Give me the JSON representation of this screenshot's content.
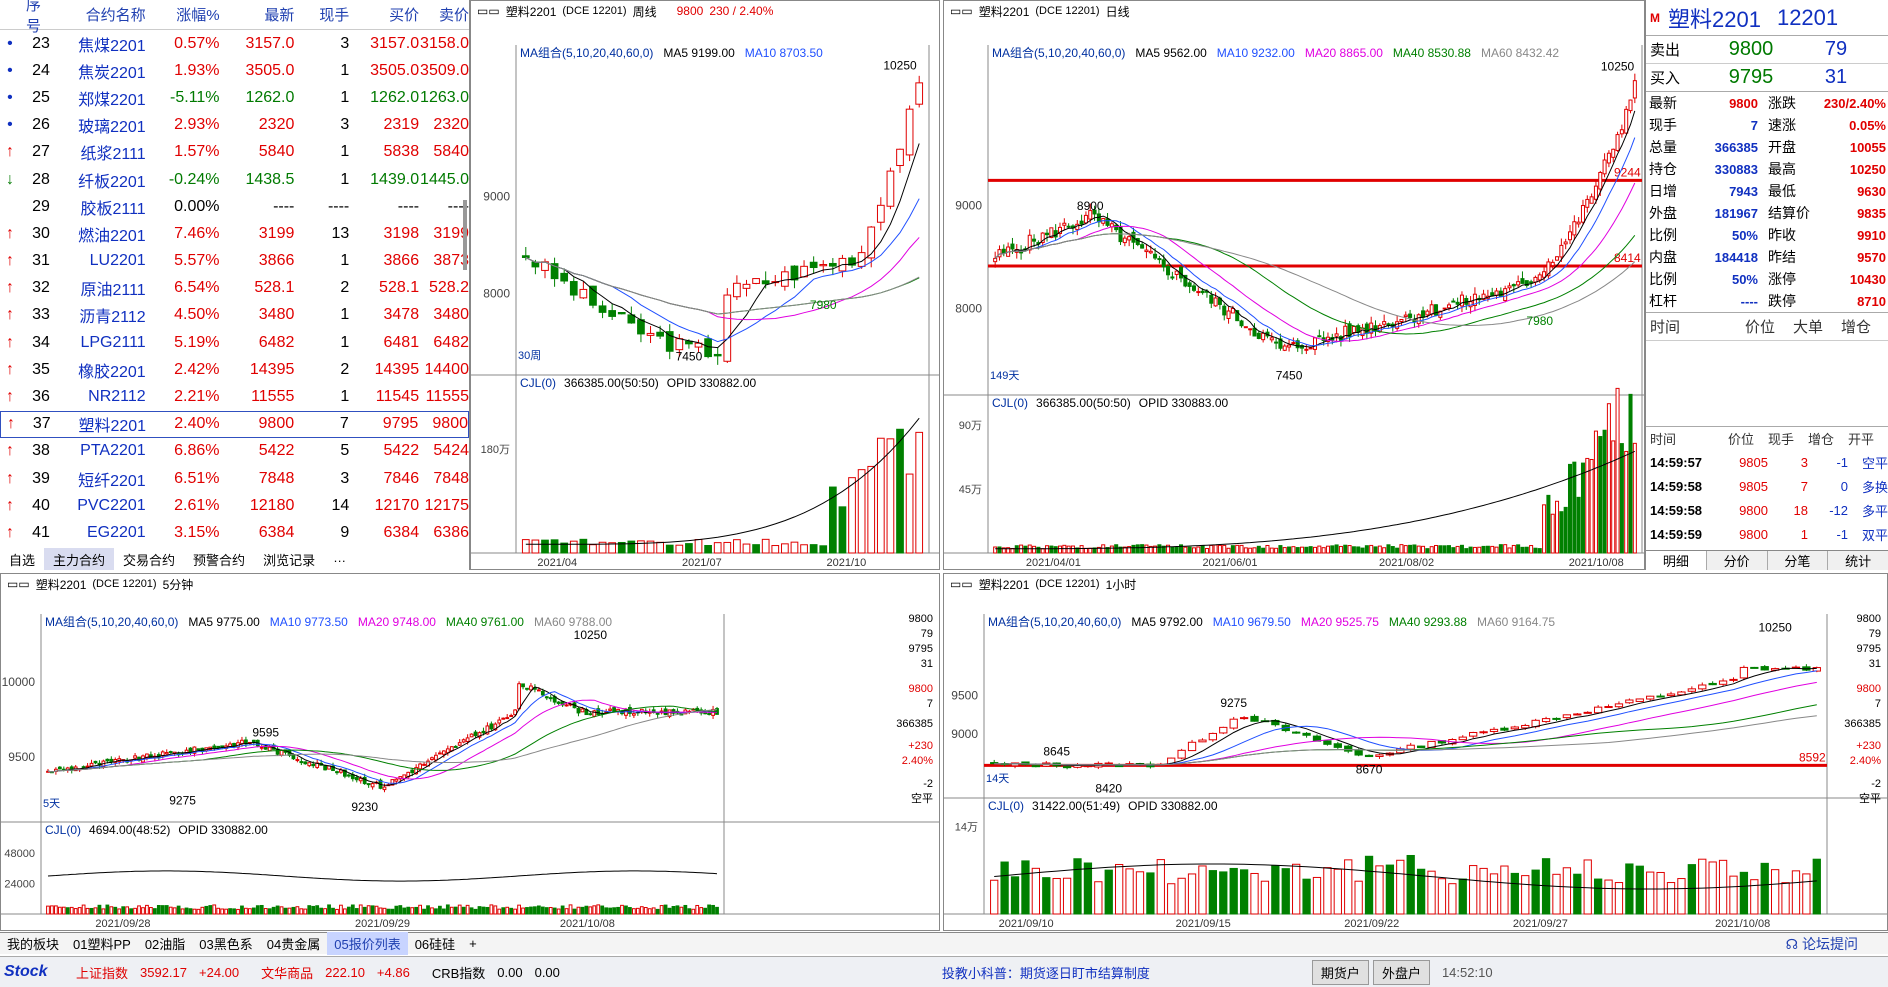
{
  "quote": {
    "headers": [
      "序号",
      "合约名称",
      "涨幅%",
      "最新",
      "现手",
      "买价",
      "卖价"
    ],
    "rows": [
      {
        "no": "23",
        "name": "焦煤2201",
        "chg": "0.57%",
        "last": "3157.0",
        "vol": "3",
        "bid": "3157.0",
        "ask": "3158.0",
        "dir": "dot",
        "up": true
      },
      {
        "no": "24",
        "name": "焦炭2201",
        "chg": "1.93%",
        "last": "3505.0",
        "vol": "1",
        "bid": "3505.0",
        "ask": "3509.0",
        "dir": "dot",
        "up": true
      },
      {
        "no": "25",
        "name": "郑煤2201",
        "chg": "-5.11%",
        "last": "1262.0",
        "vol": "1",
        "bid": "1262.0",
        "ask": "1263.0",
        "dir": "dot",
        "up": false
      },
      {
        "no": "26",
        "name": "玻璃2201",
        "chg": "2.93%",
        "last": "2320",
        "vol": "3",
        "bid": "2319",
        "ask": "2320",
        "dir": "dot",
        "up": true
      },
      {
        "no": "27",
        "name": "纸浆2111",
        "chg": "1.57%",
        "last": "5840",
        "vol": "1",
        "bid": "5838",
        "ask": "5840",
        "dir": "↑",
        "up": true
      },
      {
        "no": "28",
        "name": "纤板2201",
        "chg": "-0.24%",
        "last": "1438.5",
        "vol": "1",
        "bid": "1439.0",
        "ask": "1445.0",
        "dir": "↓",
        "up": false
      },
      {
        "no": "29",
        "name": "胶板2111",
        "chg": "0.00%",
        "last": "----",
        "vol": "----",
        "bid": "----",
        "ask": "----",
        "dir": "",
        "up": null
      },
      {
        "no": "30",
        "name": "燃油2201",
        "chg": "7.46%",
        "last": "3199",
        "vol": "13",
        "bid": "3198",
        "ask": "3199",
        "dir": "↑",
        "up": true
      },
      {
        "no": "31",
        "name": "LU2201",
        "chg": "5.57%",
        "last": "3866",
        "vol": "1",
        "bid": "3866",
        "ask": "3873",
        "dir": "↑",
        "up": true
      },
      {
        "no": "32",
        "name": "原油2111",
        "chg": "6.54%",
        "last": "528.1",
        "vol": "2",
        "bid": "528.1",
        "ask": "528.2",
        "dir": "↑",
        "up": true
      },
      {
        "no": "33",
        "name": "沥青2112",
        "chg": "4.50%",
        "last": "3480",
        "vol": "1",
        "bid": "3478",
        "ask": "3480",
        "dir": "↑",
        "up": true
      },
      {
        "no": "34",
        "name": "LPG2111",
        "chg": "5.19%",
        "last": "6482",
        "vol": "1",
        "bid": "6481",
        "ask": "6482",
        "dir": "↑",
        "up": true
      },
      {
        "no": "35",
        "name": "橡胶2201",
        "chg": "2.42%",
        "last": "14395",
        "vol": "2",
        "bid": "14395",
        "ask": "14400",
        "dir": "↑",
        "up": true
      },
      {
        "no": "36",
        "name": "NR2112",
        "chg": "2.21%",
        "last": "11555",
        "vol": "1",
        "bid": "11545",
        "ask": "11555",
        "dir": "↑",
        "up": true
      },
      {
        "no": "37",
        "name": "塑料2201",
        "chg": "2.40%",
        "last": "9800",
        "vol": "7",
        "bid": "9795",
        "ask": "9800",
        "dir": "↑",
        "up": true,
        "sel": true
      },
      {
        "no": "38",
        "name": "PTA2201",
        "chg": "6.86%",
        "last": "5422",
        "vol": "5",
        "bid": "5422",
        "ask": "5424",
        "dir": "↑",
        "up": true
      },
      {
        "no": "39",
        "name": "短纤2201",
        "chg": "6.51%",
        "last": "7848",
        "vol": "3",
        "bid": "7846",
        "ask": "7848",
        "dir": "↑",
        "up": true
      },
      {
        "no": "40",
        "name": "PVC2201",
        "chg": "2.61%",
        "last": "12180",
        "vol": "14",
        "bid": "12170",
        "ask": "12175",
        "dir": "↑",
        "up": true
      },
      {
        "no": "41",
        "name": "EG2201",
        "chg": "3.15%",
        "last": "6384",
        "vol": "9",
        "bid": "6384",
        "ask": "6386",
        "dir": "↑",
        "up": true
      }
    ],
    "tabs": [
      "自选",
      "主力合约",
      "交易合约",
      "预警合约",
      "浏览记录",
      "…"
    ]
  },
  "weekly": {
    "title": "塑料2201",
    "code": "(DCE 12201)",
    "period": "周线",
    "price": "9800",
    "chg": "230 / 2.40%",
    "ma": "MA组合(5,10,20,40,60,0)",
    "ma5": "MA5 9199.00",
    "ma10": "MA10 8703.50",
    "hi": "10250",
    "lo": "7450",
    "lo2": "7980",
    "y1": "9000",
    "y2": "8000",
    "cnt": "30周",
    "vol": "CJL(0)",
    "volv": "366385.00(50:50)",
    "opid": "OPID 330882.00",
    "vy": "180万",
    "dates": [
      "2021/04",
      "2021/07",
      "2021/10"
    ]
  },
  "daily": {
    "title": "塑料2201",
    "code": "(DCE 12201)",
    "period": "日线",
    "ma": "MA组合(5,10,20,40,60,0)",
    "ma5": "MA5 9562.00",
    "ma10": "MA10 9232.00",
    "ma20": "MA20 8865.00",
    "ma40": "MA40 8530.88",
    "ma60": "MA60 8432.42",
    "hi": "10250",
    "l1": "8900",
    "lo": "7450",
    "lo2": "7980",
    "r1": "9244",
    "r2": "8414",
    "y1": "9000",
    "y2": "8000",
    "cnt": "149天",
    "vol": "CJL(0)",
    "volv": "366385.00(50:50)",
    "opid": "OPID 330883.00",
    "vy1": "90万",
    "vy2": "45万",
    "dates": [
      "2021/04/01",
      "2021/06/01",
      "2021/08/02",
      "2021/10/08"
    ]
  },
  "info": {
    "title": "塑料2201",
    "code": "12201",
    "sell": {
      "label": "卖出",
      "price": "9800",
      "qty": "79"
    },
    "buy": {
      "label": "买入",
      "price": "9795",
      "qty": "31"
    },
    "rows": [
      [
        "最新",
        "9800",
        "涨跌",
        "230/2.40%"
      ],
      [
        "现手",
        "7",
        "速涨",
        "0.05%"
      ],
      [
        "总量",
        "366385",
        "开盘",
        "10055"
      ],
      [
        "持仓",
        "330883",
        "最高",
        "10250"
      ],
      [
        "日增",
        "7943",
        "最低",
        "9630"
      ],
      [
        "外盘",
        "181967",
        "结算价",
        "9835"
      ],
      [
        "比例",
        "50%",
        "昨收",
        "9910"
      ],
      [
        "内盘",
        "184418",
        "昨结",
        "9570"
      ],
      [
        "比例",
        "50%",
        "涨停",
        "10430"
      ],
      [
        "杠杆",
        "----",
        "跌停",
        "8710"
      ]
    ],
    "th1": [
      "时间",
      "价位",
      "大单",
      "增仓"
    ],
    "th2": [
      "时间",
      "价位",
      "现手",
      "增仓",
      "开平"
    ],
    "ticks": [
      [
        "14:59:57",
        "9805",
        "3",
        "-1",
        "空平"
      ],
      [
        "14:59:58",
        "9805",
        "7",
        "0",
        "多换"
      ],
      [
        "14:59:58",
        "9800",
        "18",
        "-12",
        "多平"
      ],
      [
        "14:59:59",
        "9800",
        "1",
        "-1",
        "双平"
      ],
      [
        "14:59:59",
        "9800",
        "7",
        "-2",
        "空平"
      ]
    ],
    "tabs": [
      "明细",
      "分价",
      "分笔",
      "统计"
    ]
  },
  "m5": {
    "title": "塑料2201",
    "code": "(DCE 12201)",
    "period": "5分钟",
    "ma": "MA组合(5,10,20,40,60,0)",
    "ma5": "MA5 9775.00",
    "ma10": "MA10 9773.50",
    "ma20": "MA20 9748.00",
    "ma40": "MA40 9761.00",
    "ma60": "MA60 9788.00",
    "hi": "10250",
    "p1": "9595",
    "p2": "9275",
    "p3": "9230",
    "y1": "10000",
    "y2": "9500",
    "cnt": "5天",
    "vol": "CJL(0)",
    "volv": "4694.00(48:52)",
    "opid": "OPID 330882.00",
    "vy1": "48000",
    "vy2": "24000",
    "dates": [
      "2021/09/28",
      "2021/09/29",
      "2021/10/08"
    ],
    "side": [
      "9800",
      "79",
      "9795",
      "31",
      "9800",
      "7",
      "366385",
      "+230",
      "2.40%",
      "-2",
      "空平"
    ]
  },
  "h1": {
    "title": "塑料2201",
    "code": "(DCE 12201)",
    "period": "1小时",
    "ma": "MA组合(5,10,20,40,60,0)",
    "ma5": "MA5 9792.00",
    "ma10": "MA10 9679.50",
    "ma20": "MA20 9525.75",
    "ma40": "MA40 9293.88",
    "ma60": "MA60 9164.75",
    "hi": "10250",
    "p1": "9275",
    "p2": "8645",
    "p3": "8420",
    "p4": "8670",
    "r1": "8592",
    "y1": "9500",
    "y2": "9000",
    "cnt": "14天",
    "vol": "CJL(0)",
    "volv": "31422.00(51:49)",
    "opid": "OPID 330882.00",
    "vy": "14万",
    "dates": [
      "2021/09/10",
      "2021/09/15",
      "2021/09/22",
      "2021/09/27",
      "2021/10/08"
    ],
    "side": [
      "9800",
      "79",
      "9795",
      "31",
      "9800",
      "7",
      "366385",
      "+230",
      "2.40%",
      "-2",
      "空平"
    ]
  },
  "bottom": {
    "tabs": [
      "我的板块",
      "01塑料PP",
      "02油脂",
      "03黑色系",
      "04贵金属",
      "05报价列表",
      "06硅硅",
      "+"
    ],
    "help": "论坛提问"
  },
  "status": {
    "logo": "Stock",
    "i1": "上证指数",
    "v1": "3592.17",
    "d1": "+24.00",
    "i2": "文华商品",
    "v2": "222.10",
    "d2": "+4.86",
    "i3": "CRB指数",
    "v3": "0.00",
    "d3": "0.00",
    "tip": "投教小科普：期货逐日盯市结算制度",
    "b1": "期货户",
    "b2": "外盘户",
    "clock": "14:52:10"
  }
}
